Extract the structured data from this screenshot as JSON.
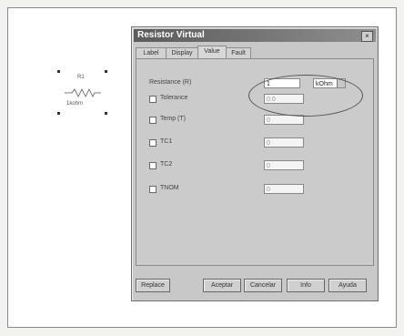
{
  "schematic": {
    "ref": "R1",
    "value": "1kohm"
  },
  "dialog": {
    "title": "Resistor Virtual",
    "close_glyph": "×",
    "tabs": [
      "Label",
      "Display",
      "Value",
      "Fault"
    ],
    "active_tab": "Value",
    "rows": [
      {
        "label": "Resistance (R)",
        "value": "1",
        "unit": "kOhm",
        "checkbox": false
      },
      {
        "label": "Tolerance",
        "value": "0.0",
        "checkbox": true
      },
      {
        "label": "Temp (T)",
        "value": "0",
        "checkbox": true
      },
      {
        "label": "TC1",
        "value": "0",
        "checkbox": true
      },
      {
        "label": "TC2",
        "value": "0",
        "checkbox": true
      },
      {
        "label": "TNOM",
        "value": "0",
        "checkbox": true
      }
    ],
    "buttons": [
      "Replace",
      "Aceptar",
      "Cancelar",
      "Info",
      "Ayuda"
    ]
  }
}
